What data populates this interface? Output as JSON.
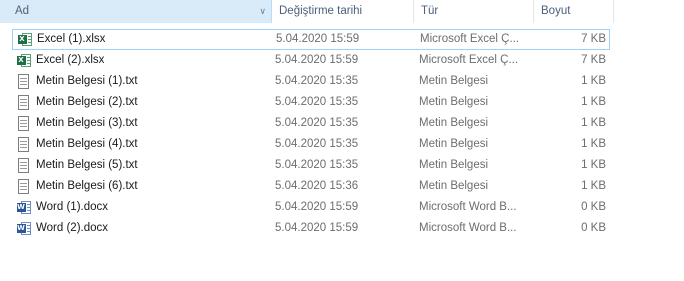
{
  "columns": {
    "name": "Ad",
    "date": "Değiştirme tarihi",
    "type": "Tür",
    "size": "Boyut"
  },
  "accent": "#d9ebf9",
  "sort_glyph": "^",
  "files": [
    {
      "icon": "excel-icon",
      "name": "Excel (1).xlsx",
      "date": "5.04.2020 15:59",
      "type": "Microsoft Excel Ç...",
      "size": "7 KB"
    },
    {
      "icon": "excel-icon",
      "name": "Excel (2).xlsx",
      "date": "5.04.2020 15:59",
      "type": "Microsoft Excel Ç...",
      "size": "7 KB"
    },
    {
      "icon": "text-file-icon",
      "name": "Metin Belgesi (1).txt",
      "date": "5.04.2020 15:35",
      "type": "Metin Belgesi",
      "size": "1 KB"
    },
    {
      "icon": "text-file-icon",
      "name": "Metin Belgesi (2).txt",
      "date": "5.04.2020 15:35",
      "type": "Metin Belgesi",
      "size": "1 KB"
    },
    {
      "icon": "text-file-icon",
      "name": "Metin Belgesi (3).txt",
      "date": "5.04.2020 15:35",
      "type": "Metin Belgesi",
      "size": "1 KB"
    },
    {
      "icon": "text-file-icon",
      "name": "Metin Belgesi (4).txt",
      "date": "5.04.2020 15:35",
      "type": "Metin Belgesi",
      "size": "1 KB"
    },
    {
      "icon": "text-file-icon",
      "name": "Metin Belgesi (5).txt",
      "date": "5.04.2020 15:35",
      "type": "Metin Belgesi",
      "size": "1 KB"
    },
    {
      "icon": "text-file-icon",
      "name": "Metin Belgesi (6).txt",
      "date": "5.04.2020 15:36",
      "type": "Metin Belgesi",
      "size": "1 KB"
    },
    {
      "icon": "word-icon",
      "name": "Word (1).docx",
      "date": "5.04.2020 15:59",
      "type": "Microsoft Word B...",
      "size": "0 KB"
    },
    {
      "icon": "word-icon",
      "name": "Word (2).docx",
      "date": "5.04.2020 15:59",
      "type": "Microsoft Word B...",
      "size": "0 KB"
    }
  ]
}
